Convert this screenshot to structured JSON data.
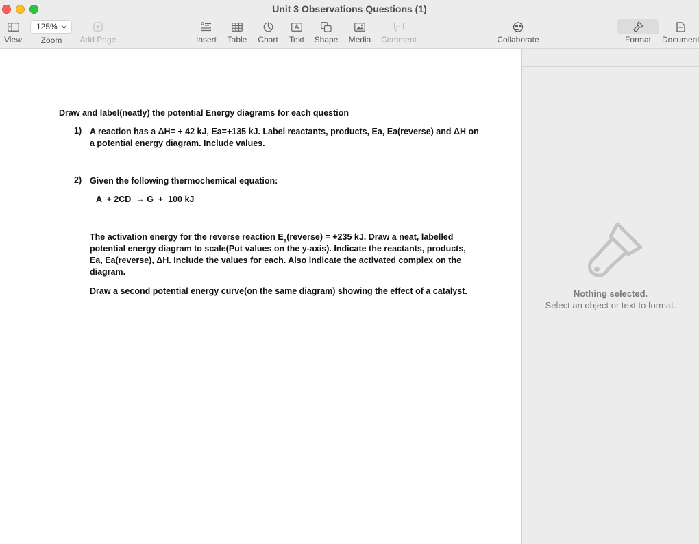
{
  "window": {
    "title": "Unit 3 Observations Questions (1)"
  },
  "toolbar": {
    "view_label": "View",
    "zoom_value": "125%",
    "zoom_label": "Zoom",
    "add_page_label": "Add Page",
    "insert_label": "Insert",
    "table_label": "Table",
    "chart_label": "Chart",
    "text_label": "Text",
    "shape_label": "Shape",
    "media_label": "Media",
    "comment_label": "Comment",
    "collaborate_label": "Collaborate",
    "format_label": "Format",
    "document_label": "Document"
  },
  "document": {
    "heading": "Draw and label(neatly) the potential Energy diagrams for each question",
    "q1_number": "1)",
    "q1_line1": "A reaction has a ΔH= + 42 kJ, Ea=+135 kJ. Label reactants, products, Ea, Ea(reverse) and ΔH on",
    "q1_line2": "a potential energy diagram. Include values.",
    "q2_number": "2)",
    "q2_intro": "Given the following thermochemical equation:",
    "equation": "A  + 2CD  → G  +  100 kJ",
    "q2_p1_a": "The activation energy for the reverse reaction E",
    "q2_p1_sub": "a",
    "q2_p1_b": "(reverse) = +235 kJ. Draw a neat, labelled",
    "q2_p1_line2": "potential energy diagram to scale(Put values on the y-axis). Indicate the reactants, products,",
    "q2_p1_line3": "Ea, Ea(reverse), ΔH. Include the values for each. Also indicate the activated complex on the",
    "q2_p1_line4": "diagram.",
    "q2_p2": "Draw a second potential energy curve(on the same diagram) showing the effect of a catalyst."
  },
  "sidebar": {
    "nothing_selected": "Nothing selected.",
    "hint": "Select an object or text to format."
  },
  "icons": {
    "view": "sidebar-icon",
    "add_page": "add-page-icon",
    "insert": "insert-list-icon",
    "table": "table-icon",
    "chart": "chart-icon",
    "text": "text-box-icon",
    "shape": "shape-icon",
    "media": "media-icon",
    "comment": "comment-icon",
    "collaborate": "collaborate-icon",
    "format": "paintbrush-icon",
    "document": "document-icon"
  }
}
